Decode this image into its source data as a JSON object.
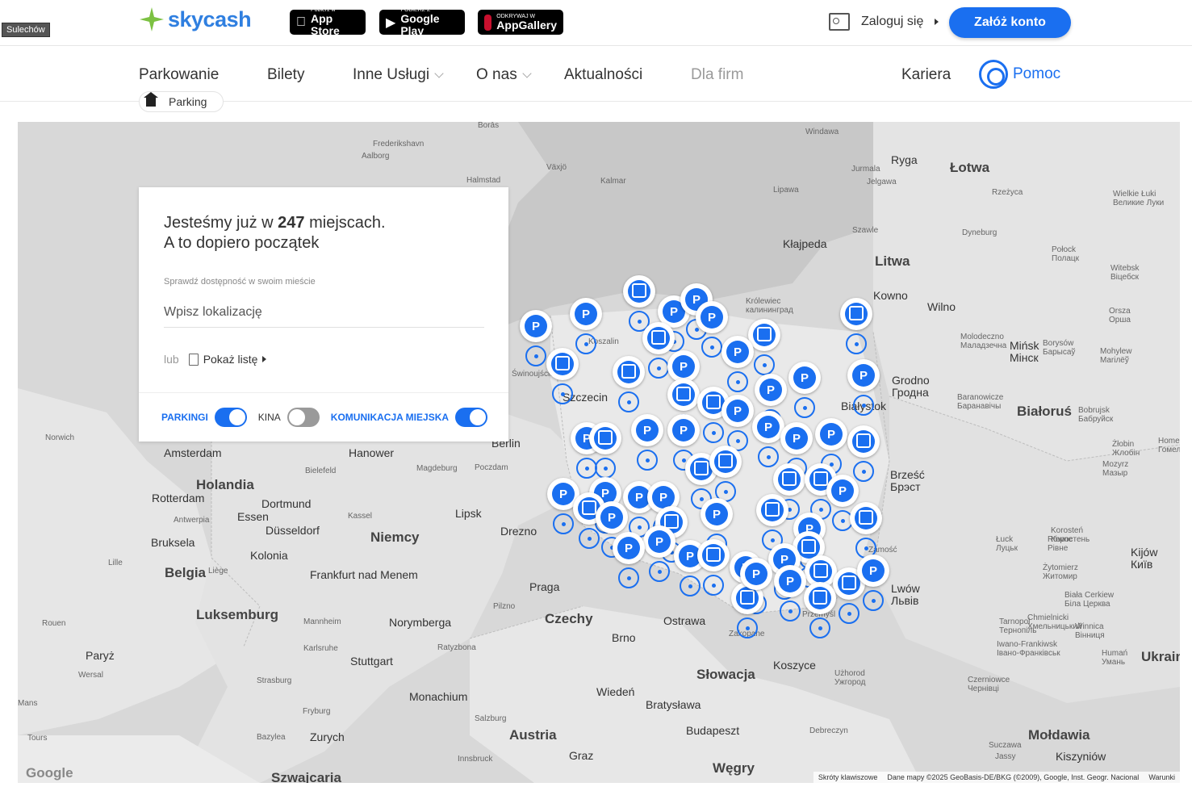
{
  "tooltip": "Sulechów",
  "logo": {
    "text": "skycash"
  },
  "stores": [
    {
      "small": "Pobierz w",
      "big": "App Store"
    },
    {
      "small": "POBIERZ Z",
      "big": "Google Play"
    },
    {
      "small": "ODKRYWAJ W",
      "big": "AppGallery"
    }
  ],
  "header": {
    "login": "Zaloguj się",
    "create_account": "Załóż konto"
  },
  "nav": {
    "items": [
      "Parkowanie",
      "Bilety",
      "Inne Usługi",
      "O nas",
      "Aktualności",
      "Dla firm",
      "Kariera"
    ],
    "help": "Pomoc"
  },
  "breadcrumb": {
    "label": "Parking"
  },
  "panel": {
    "title_pre": "Jesteśmy już w ",
    "count": "247",
    "title_post": " miejscach.",
    "title_line2": "A to dopiero początek",
    "check_label": "Sprawdź dostępność w swoim mieście",
    "input_placeholder": "Wpisz lokalizację",
    "or": "lub",
    "show_list": "Pokaż listę",
    "toggles": [
      {
        "label": "PARKINGI",
        "on": true
      },
      {
        "label": "KINA",
        "on": false
      },
      {
        "label": "KOMUNIKACJA MIEJSKA",
        "on": true
      }
    ]
  },
  "map": {
    "labels": {
      "countries": [
        "Łotwa",
        "Litwa",
        "Białoruś",
        "Niemcy",
        "Czechy",
        "Słowacja",
        "Węgry",
        "Austria",
        "Holandia",
        "Belgia",
        "Luksemburg",
        "Mołdawia",
        "Ukrain",
        "Szwajcaria"
      ],
      "cities": [
        "Ryga",
        "Kowno",
        "Wilno",
        "Mińsk\nМінск",
        "Kłajpeda",
        "Berlin",
        "Hanower",
        "Amsterdam",
        "Rotterdam",
        "Bruksela",
        "Dortmund",
        "Düsseldorf",
        "Kolonia",
        "Essen",
        "Lipsk",
        "Drezno",
        "Praga",
        "Brno",
        "Wiedeń",
        "Bratysława",
        "Budapeszt",
        "Norymberga",
        "Stuttgart",
        "Monachium",
        "Zurych",
        "Frankfurt nad Menem",
        "Paryż",
        "Lwów\nЛьвів",
        "Koszyce",
        "Ostrawa",
        "Kijów\nКиїв",
        "Kiszyniów",
        "Graz",
        "Szczecin",
        "Białystok",
        "Grodno\nГродна",
        "Brześć\nБрэст"
      ],
      "small": [
        "Borås",
        "Frederikshavn",
        "Aalborg",
        "Halmstad",
        "Växjö",
        "Kalmar",
        "Windawa",
        "Jurmala",
        "Jelgawa",
        "Lipawa",
        "Rzeżyca",
        "Szawle",
        "Dyneburg",
        "Połock\nПолацк",
        "Witebsk\nВіцебск",
        "Wielkie Łuki\nВеликие Луки",
        "Molodeczno\nМаладзечна",
        "Borysów\nБарысаў",
        "Mohylew\nMariлёў",
        "Orsza\nОрша",
        "Baranowicze\nБаранавічы",
        "Bobrujsk\nБабруйск",
        "Homel\nГомель",
        "Żłobin\nЖлобін",
        "Mozyrz\nМазыр",
        "Łuck\nЛуцьк",
        "Równe\nРівне",
        "Korosteń\nКоростень",
        "Żytomierz\nЖитомир",
        "Biała Cerkiew\nБіла Церква",
        "Tarnopol\nТернопіль",
        "Chmielnicki\nХмельницький",
        "Winnica\nВінниця",
        "Iwano-Frankiwsk\nІвано-Франківськ",
        "Czerniowce\nЧернівці",
        "Humań\nУмань",
        "Użhorod\nУжгород",
        "Debreczyn",
        "Suczawa",
        "Jassy",
        "Norwich",
        "Bielefeld",
        "Magdeburg",
        "Kassel",
        "Antwerpia",
        "Lille",
        "Liège",
        "Mannheim",
        "Karlsruhe",
        "Strasburg",
        "Fryburg",
        "Bazylea",
        "Innsbruck",
        "Salzburg",
        "Pilzno",
        "Ratyzbona",
        "Rouen",
        "Wersal",
        "Tours",
        "Mans",
        "Królewiec\nкалининград",
        "Poczdam",
        "Koszalin",
        "Świnoujście",
        "Zakopane",
        "Przemyśl",
        "Zamość"
      ]
    },
    "attribution": [
      "Skróty klawiszowe",
      "Dane mapy ©2025 GeoBasis-DE/BKG (©2009), Google, Inst. Geogr. Nacional",
      "Warunki"
    ],
    "brand": "Google"
  }
}
